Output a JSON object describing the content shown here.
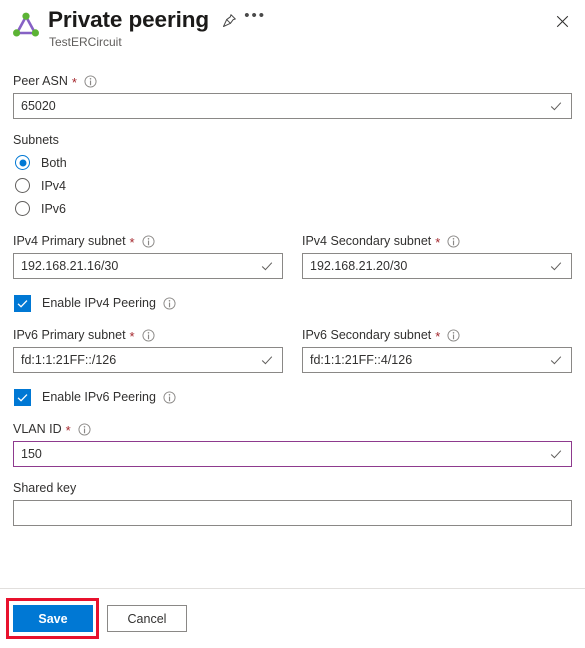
{
  "header": {
    "title": "Private peering",
    "subtitle": "TestERCircuit",
    "resource_icon": "expressroute-circuit-icon",
    "pin_label": "Pin",
    "more_label": "More",
    "close_label": "Close"
  },
  "form": {
    "peer_asn": {
      "label": "Peer ASN",
      "required_mark": "*",
      "value": "65020",
      "info": "info-icon",
      "validated": true
    },
    "subnets": {
      "label": "Subnets",
      "selected": "Both",
      "options": [
        {
          "label": "Both",
          "selected": true
        },
        {
          "label": "IPv4",
          "selected": false
        },
        {
          "label": "IPv6",
          "selected": false
        }
      ]
    },
    "ipv4_primary": {
      "label": "IPv4 Primary subnet",
      "required_mark": "*",
      "value": "192.168.21.16/30"
    },
    "ipv4_secondary": {
      "label": "IPv4 Secondary subnet",
      "required_mark": "*",
      "value": "192.168.21.20/30"
    },
    "enable_ipv4": {
      "label": "Enable IPv4 Peering",
      "checked": true
    },
    "ipv6_primary": {
      "label": "IPv6 Primary subnet",
      "required_mark": "*",
      "value": "fd:1:1:21FF::/126"
    },
    "ipv6_secondary": {
      "label": "IPv6 Secondary subnet",
      "required_mark": "*",
      "value": "fd:1:1:21FF::4/126"
    },
    "enable_ipv6": {
      "label": "Enable IPv6 Peering",
      "checked": true
    },
    "vlan_id": {
      "label": "VLAN ID",
      "required_mark": "*",
      "value": "150",
      "focused": true
    },
    "shared_key": {
      "label": "Shared key",
      "value": "",
      "placeholder": ""
    }
  },
  "footer": {
    "save_label": "Save",
    "cancel_label": "Cancel"
  },
  "colors": {
    "accent": "#0078d4",
    "required": "#a4262c",
    "focus_border": "#8e3a8e",
    "annotation": "#e8112d",
    "icon_purple": "#8661c5",
    "icon_green": "#5cb335"
  }
}
